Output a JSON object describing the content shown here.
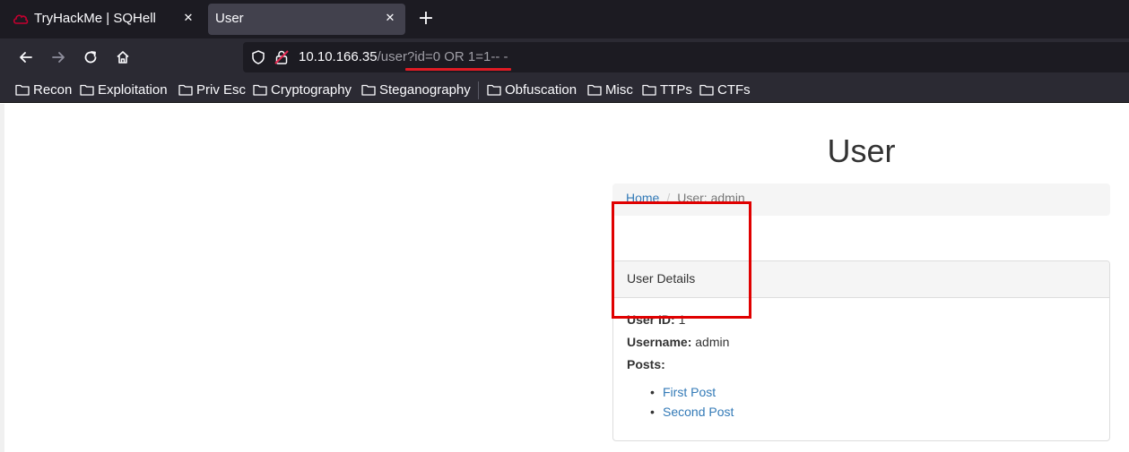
{
  "browser": {
    "tabs": [
      {
        "title": "TryHackMe | SQHell",
        "active": false,
        "close": "✕"
      },
      {
        "title": "User",
        "active": true,
        "close": "✕"
      }
    ],
    "new_tab": "+",
    "url": {
      "host": "10.10.166.35",
      "path": "/user?id=0 OR 1=1-- -"
    },
    "bookmarks": [
      "Recon",
      "Exploitation",
      "Priv Esc",
      "Cryptography",
      "Steganography",
      "Obfuscation",
      "Misc",
      "TTPs",
      "CTFs"
    ],
    "colors": {
      "tabbar": "#1c1b22",
      "toolbar": "#2b2a33",
      "highlight": "#e01b24"
    }
  },
  "page": {
    "title": "User",
    "breadcrumb": {
      "home": "Home",
      "separator": "/",
      "current": "User: admin"
    },
    "panel": {
      "heading": "User Details",
      "user_id_label": "User ID:",
      "user_id_value": "1",
      "username_label": "Username:",
      "username_value": "admin",
      "posts_label": "Posts:",
      "posts": [
        "First Post",
        "Second Post"
      ]
    },
    "colors": {
      "link": "#337ab7",
      "annotation_box": "#e00000"
    }
  }
}
